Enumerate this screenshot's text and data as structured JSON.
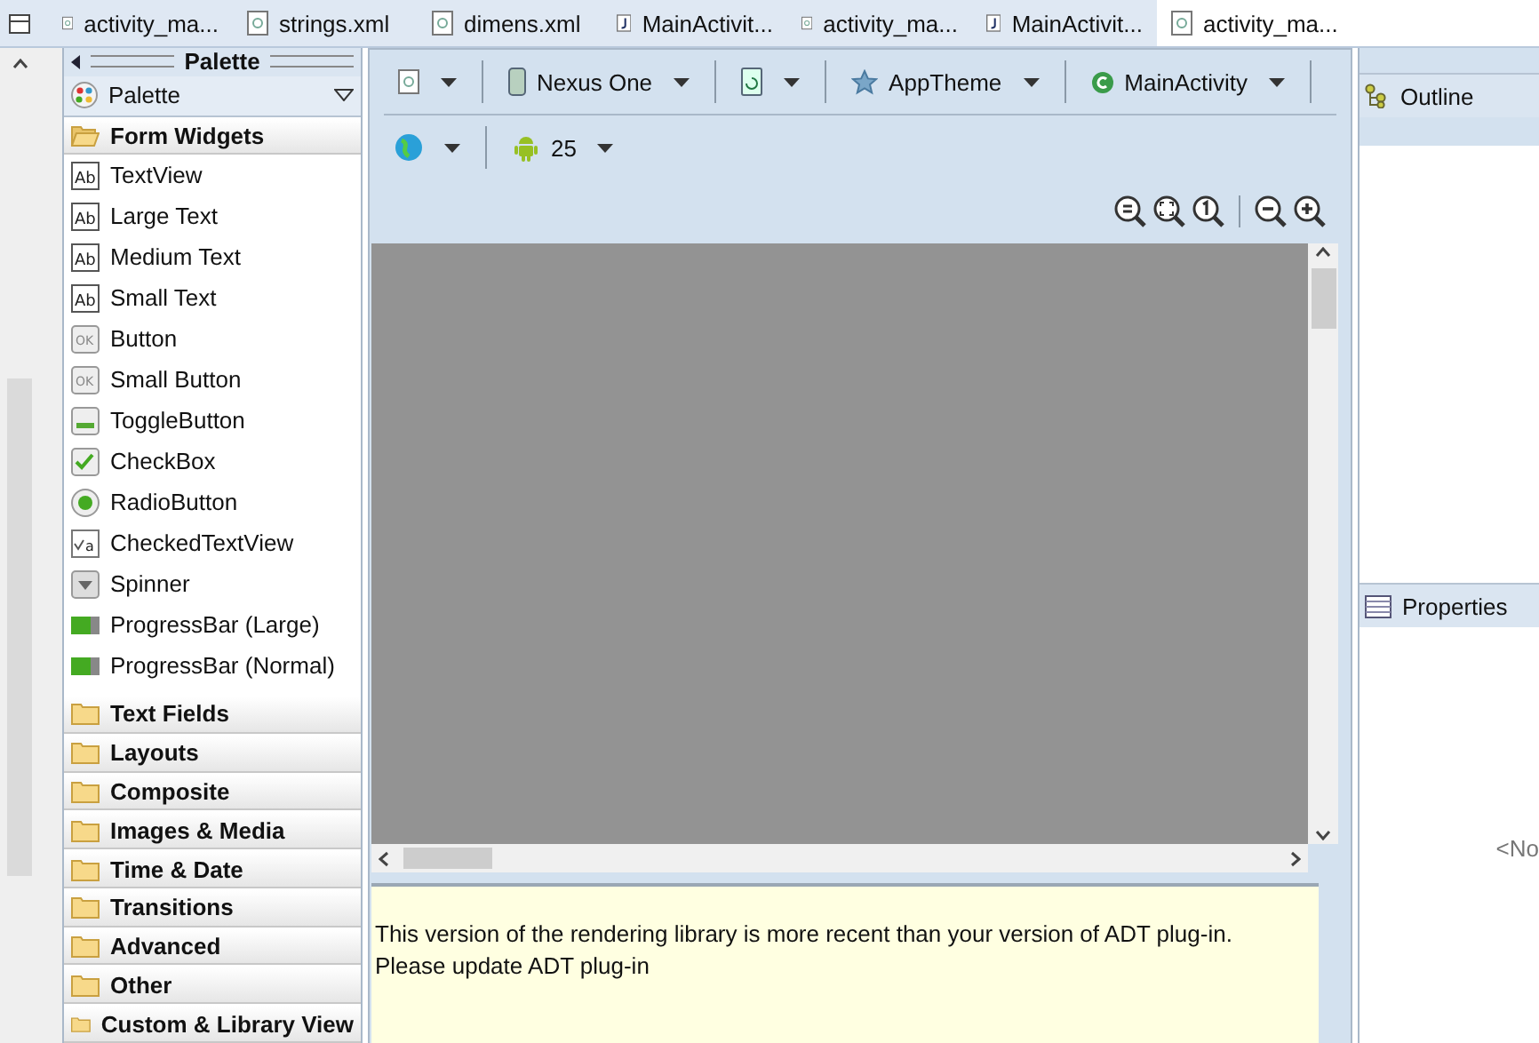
{
  "tabs": [
    {
      "label": "activity_ma...",
      "kind": "xml",
      "selected": false
    },
    {
      "label": "strings.xml",
      "kind": "xml",
      "selected": false
    },
    {
      "label": "dimens.xml",
      "kind": "xml",
      "selected": false
    },
    {
      "label": "MainActivit...",
      "kind": "java",
      "selected": false
    },
    {
      "label": "activity_ma...",
      "kind": "xml",
      "selected": false
    },
    {
      "label": "MainActivit...",
      "kind": "java",
      "selected": false
    },
    {
      "label": "activity_ma...",
      "kind": "xml",
      "selected": true
    }
  ],
  "palette": {
    "title": "Palette",
    "selector": "Palette",
    "categories": [
      {
        "label": "Form Widgets",
        "expanded": true,
        "items": [
          {
            "label": "TextView",
            "kind": "text",
            "icon_text": "Ab"
          },
          {
            "label": "Large Text",
            "kind": "text",
            "icon_text": "Ab"
          },
          {
            "label": "Medium Text",
            "kind": "text",
            "icon_text": "Ab"
          },
          {
            "label": "Small Text",
            "kind": "text",
            "icon_text": "Ab"
          },
          {
            "label": "Button",
            "kind": "button",
            "icon_text": "OK"
          },
          {
            "label": "Small Button",
            "kind": "button",
            "icon_text": "OK"
          },
          {
            "label": "ToggleButton",
            "kind": "toggle"
          },
          {
            "label": "CheckBox",
            "kind": "checkbox"
          },
          {
            "label": "RadioButton",
            "kind": "radio"
          },
          {
            "label": "CheckedTextView",
            "kind": "checkedtext",
            "icon_text": "a"
          },
          {
            "label": "Spinner",
            "kind": "spinner"
          },
          {
            "label": "ProgressBar (Large)",
            "kind": "progress"
          },
          {
            "label": "ProgressBar (Normal)",
            "kind": "progress"
          }
        ]
      },
      {
        "label": "Text Fields",
        "expanded": false
      },
      {
        "label": "Layouts",
        "expanded": false
      },
      {
        "label": "Composite",
        "expanded": false
      },
      {
        "label": "Images & Media",
        "expanded": false
      },
      {
        "label": "Time & Date",
        "expanded": false
      },
      {
        "label": "Transitions",
        "expanded": false
      },
      {
        "label": "Advanced",
        "expanded": false
      },
      {
        "label": "Other",
        "expanded": false
      },
      {
        "label": "Custom & Library View",
        "expanded": false
      }
    ]
  },
  "toolbar": {
    "device": "Nexus One",
    "theme": "AppTheme",
    "activity": "MainActivity",
    "api": "25"
  },
  "message": [
    "This version of the rendering library is more recent than your version of ADT plug-in.",
    "Please update ADT plug-in"
  ],
  "outline": {
    "title": "Outline"
  },
  "properties": {
    "title": "Properties",
    "placeholder": "<No"
  }
}
